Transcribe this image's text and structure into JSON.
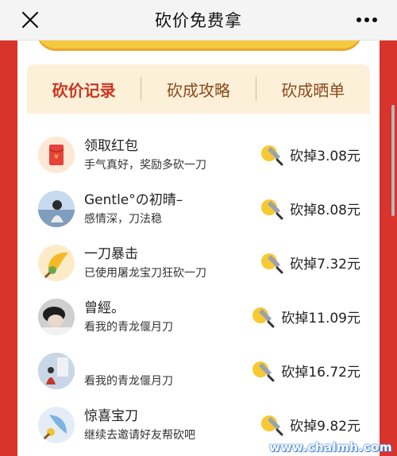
{
  "nav": {
    "title": "砍价免费拿"
  },
  "tabs": [
    {
      "label": "砍价记录",
      "active": true
    },
    {
      "label": "砍成攻略",
      "active": false
    },
    {
      "label": "砍成晒单",
      "active": false
    }
  ],
  "records": [
    {
      "name": "领取红包",
      "desc": "手气真好，奖励多砍一刀",
      "amount": "砍掉3.08元",
      "avatar": "red-envelope-icon"
    },
    {
      "name": "Gentle°の初晴–",
      "desc": "感情深，刀法稳",
      "amount": "砍掉8.08元",
      "avatar": "user-photo"
    },
    {
      "name": "一刀暴击",
      "desc": "已使用屠龙宝刀狂砍一刀",
      "amount": "砍掉7.32元",
      "avatar": "golden-blade-icon"
    },
    {
      "name": "曾經。",
      "desc": "看我的青龙偃月刀",
      "amount": "砍掉11.09元",
      "avatar": "user-photo"
    },
    {
      "name": "",
      "desc": "看我的青龙偃月刀",
      "amount": "砍掉16.72元",
      "avatar": "user-photo"
    },
    {
      "name": "惊喜宝刀",
      "desc": "继续去邀请好友帮砍吧",
      "amount": "砍掉9.82元",
      "avatar": "blue-blade-icon"
    }
  ],
  "watermark": "www.chalmh.com",
  "colors": {
    "brand_red": "#d9342b",
    "tab_bg": "#fdf0d9",
    "active_tab": "#c9361f",
    "gold": "#f5c940"
  }
}
